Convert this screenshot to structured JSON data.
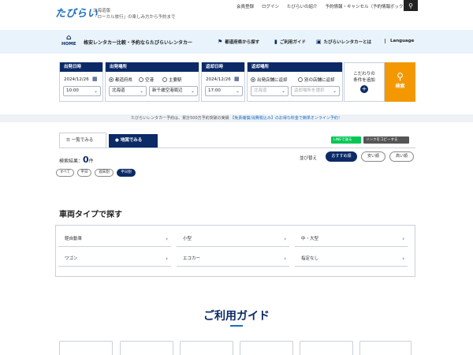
{
  "header": {
    "logo": "たびらい",
    "tagline_line1": "北海道版",
    "tagline_line2": "「ローカル旅行」の楽しみ方から予約まで",
    "links": [
      "会員登録",
      "ログイン",
      "たびらいの紹介",
      "予約情報・キャンセル（予約情報ボックス）"
    ]
  },
  "nav": {
    "home_label": "HOME",
    "title": "格安レンタカー比較・予約ならたびらいレンタカー",
    "items": [
      "都道府県から探す",
      "ご利用ガイド",
      "たびらいレンタカーとは"
    ],
    "language": "Language"
  },
  "search": {
    "depart_date_header": "出発日時",
    "depart_place_header": "出発場所",
    "return_date_header": "返却日時",
    "return_place_header": "返却場所",
    "depart_date": "2024/12/26",
    "depart_time": "10:00",
    "depart_radios": [
      "都道府県",
      "空港",
      "主要駅"
    ],
    "depart_pref": "北海道",
    "depart_area": "新千歳空港周辺",
    "return_date": "2024/12/26",
    "return_time": "17:00",
    "return_radios": [
      "出発店舗に返却",
      "別の店舗に返却"
    ],
    "return_pref": "北海道",
    "return_area": "返却場所を選択",
    "conditions_line1": "こだわりの",
    "conditions_line2": "条件を追加",
    "search_button": "検索"
  },
  "notice": {
    "text": "たびらいレンタカー予約は、累計500万予約突破の実績",
    "highlight": "【免責補償/消費税込み】のお得な料金で簡単オンライン予約！"
  },
  "tabs": {
    "list": "一覧でみる",
    "map": "地図でみる"
  },
  "share": {
    "line": "LINEで送る",
    "copy": "リンクをコピーする"
  },
  "results": {
    "label": "検索結果：",
    "count": "0",
    "unit": "件"
  },
  "sort": {
    "label": "並び替え",
    "options": [
      "おすすめ順",
      "安い順",
      "高い順"
    ]
  },
  "chips": [
    "すべて",
    "平日",
    "週末割",
    "平日割"
  ],
  "vehicle": {
    "title": "車両タイプで探す",
    "types": [
      "軽自動車",
      "小型",
      "中・大型",
      "ワゴン",
      "エコカー",
      "指定なし"
    ]
  },
  "guide": {
    "title": "ご利用ガイド"
  },
  "colors": {
    "navy": "#0b2a66",
    "orange": "#f39800",
    "line_green": "#06c755",
    "link_blue": "#1a6fc4"
  }
}
